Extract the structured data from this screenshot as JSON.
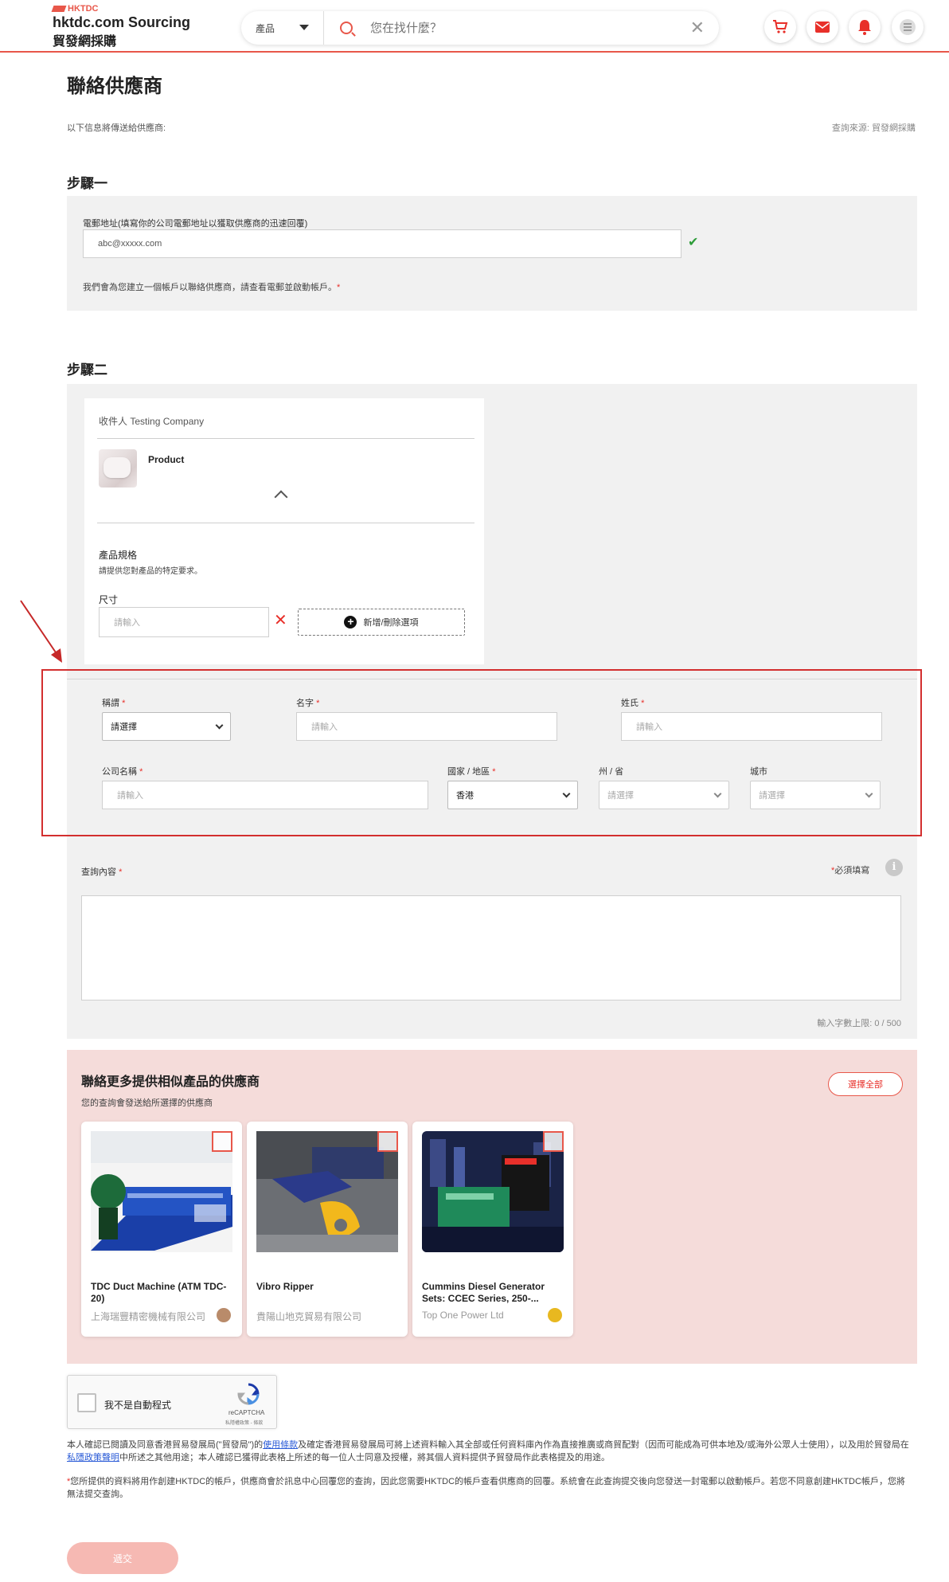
{
  "header": {
    "logo_small": "HKTDC",
    "logo_main": "hktdc.com Sourcing",
    "logo_sub": "貿發網採購",
    "search_category": "產品",
    "search_placeholder": "您在找什麼？",
    "clear_glyph": "✕",
    "icons": [
      "cart-icon",
      "mail-icon",
      "bell-icon",
      "menu-icon"
    ]
  },
  "page": {
    "title": "聯絡供應商",
    "info_left": "以下信息將傳送給供應商:",
    "info_right": "查詢來源: 貿發網採購"
  },
  "step1": {
    "title": "步驟一",
    "email_label": "電郵地址(填寫你的公司電郵地址以獲取供應商的迅速回覆)",
    "email_value": "abc@xxxxx.com",
    "valid_glyph": "✔",
    "note": "我們會為您建立一個帳戶以聯絡供應商，請查看電郵並啟動帳戶。",
    "note_star": "*"
  },
  "step2": {
    "title": "步驟二",
    "recipient_prefix": "收件人",
    "recipient_name": "Testing Company",
    "product_name": "Product",
    "collapse_glyph": "⌃",
    "spec_title": "產品規格",
    "spec_desc": "請提供您對產品的特定要求。",
    "size_label": "尺寸",
    "size_placeholder": "請輸入",
    "remove_glyph": "✕",
    "add_option_label": "新增/刪除選項",
    "add_glyph": "+"
  },
  "contact": {
    "title_label": "稱謂",
    "title_value": "請選擇",
    "first_name_label": "名字",
    "first_name_placeholder": "請輸入",
    "last_name_label": "姓氏",
    "last_name_placeholder": "請輸入",
    "company_label": "公司名稱",
    "company_placeholder": "請輸入",
    "country_label": "國家 / 地區",
    "country_value": "香港",
    "state_label": "州 / 省",
    "state_value": "請選擇",
    "city_label": "城市",
    "city_value": "請選擇",
    "required_star": "*"
  },
  "inquiry": {
    "label": "查詢內容",
    "required_note": "必須填寫",
    "info_glyph": "i",
    "char_count": "輸入字數上限: 0 / 500"
  },
  "suppliers": {
    "title": "聯絡更多提供相似產品的供應商",
    "subtitle": "您的查詢會發送給所選擇的供應商",
    "select_all": "選擇全部",
    "items": [
      {
        "name": "TDC Duct Machine (ATM TDC-20)",
        "company": "上海瑞豐精密機械有限公司",
        "badge_color": "#b98b6a"
      },
      {
        "name": "Vibro Ripper",
        "company": "貴陽山地克貿易有限公司",
        "badge_color": ""
      },
      {
        "name": "Cummins Diesel Generator Sets: CCEC Series, 250-...",
        "company": "Top One Power Ltd",
        "badge_color": "#e8b820"
      }
    ]
  },
  "captcha": {
    "label": "我不是自動程式",
    "brand": "reCAPTCHA",
    "terms": "私隱權政策 - 條款"
  },
  "legal": {
    "p1_a": "本人確認已閱讀及同意香港貿易發展局(\"貿發局\")的",
    "p1_link1": "使用條款",
    "p1_b": "及確定香港貿易發展局可將上述資料輸入其全部或任何資料庫內作為直接推廣或商貿配對（因而可能成為可供本地及/或海外公眾人士使用），以及用於貿發局在",
    "p1_link2": "私隱政策聲明",
    "p1_c": "中所述之其他用途；本人確認已獲得此表格上所述的每一位人士同意及授權，將其個人資料提供予貿發局作此表格提及的用途。",
    "p2_star": "*",
    "p2": "您所提供的資料將用作創建HKTDC的帳戶，供應商會於訊息中心回覆您的查詢，因此您需要HKTDC的帳戶查看供應商的回覆。系統會在此查詢提交後向您發送一封電郵以啟動帳戶。若您不同意創建HKTDC帳戶，您將無法提交查詢。"
  },
  "submit_label": "遞交",
  "colors": {
    "brand_red": "#e8574a",
    "highlight_border": "#d32f2f",
    "panel_gray": "#f1f1f1",
    "supplier_bg": "#f5dcda"
  }
}
